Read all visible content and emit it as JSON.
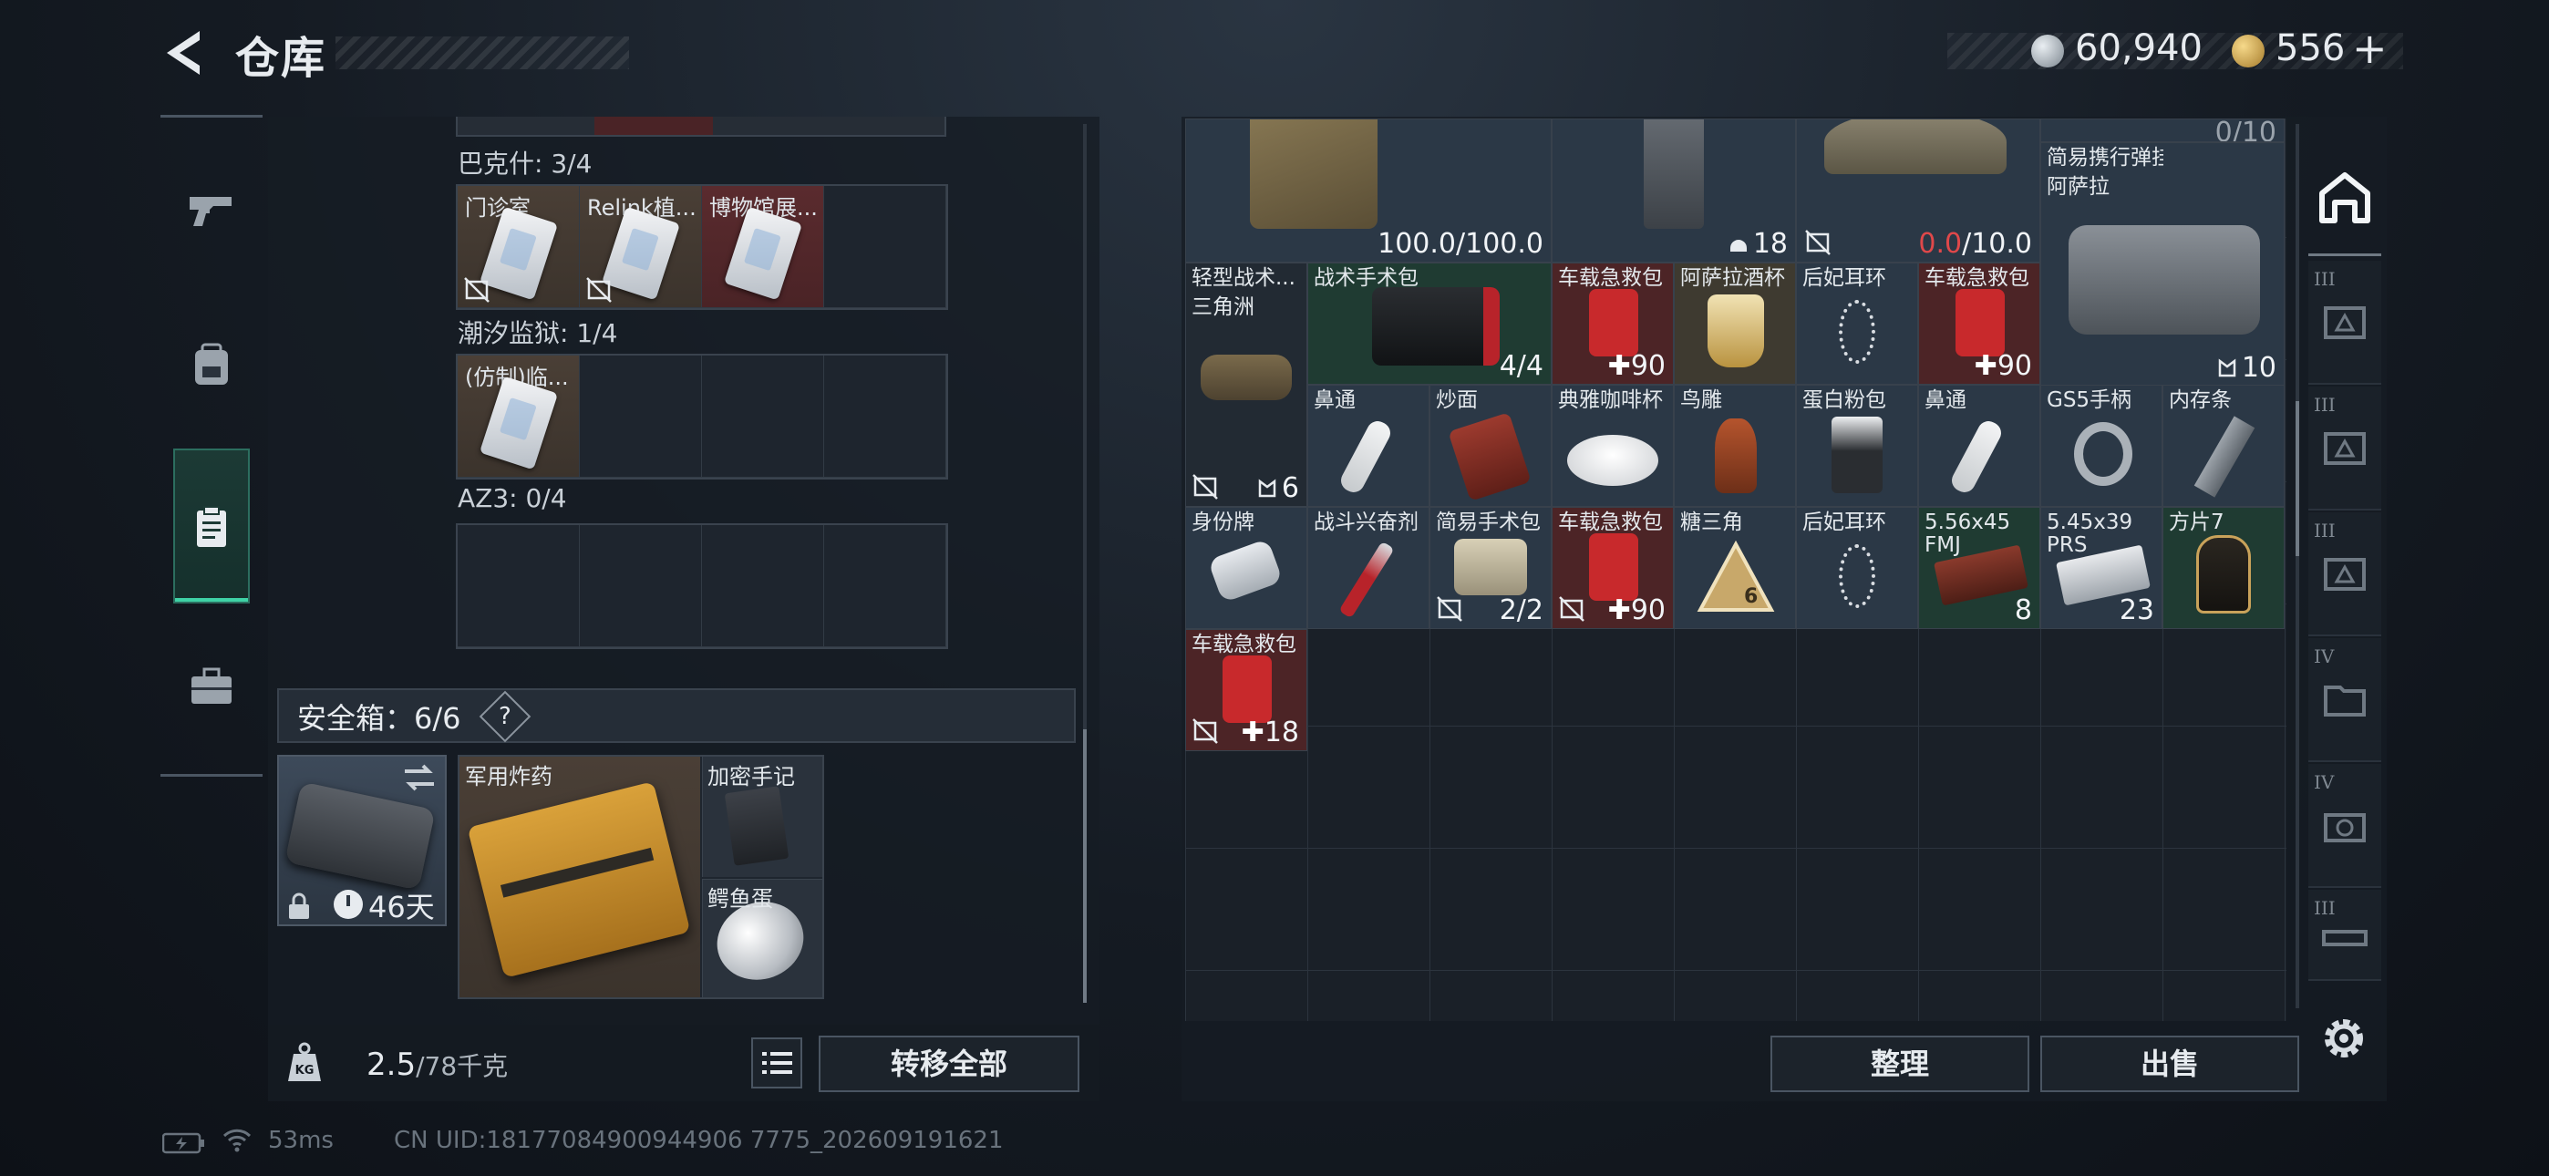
{
  "header": {
    "title": "仓库",
    "currency_silver": "60,940",
    "currency_gold": "556",
    "currency_plus": "+"
  },
  "left_rail": {
    "items": [
      {
        "icon": "pistol-icon"
      },
      {
        "icon": "backpack-icon"
      },
      {
        "icon": "clipboard-icon",
        "active": true
      },
      {
        "icon": "toolbox-icon"
      }
    ]
  },
  "collections": [
    {
      "label": "巴克什: 3/4",
      "cells": [
        "门诊室",
        "Relink植...",
        "博物馆展...",
        ""
      ]
    },
    {
      "label": "潮汐监狱: 1/4",
      "cells": [
        "(仿制)临...",
        "",
        "",
        ""
      ]
    },
    {
      "label": "AZ3: 0/4",
      "cells": [
        "",
        "",
        "",
        ""
      ]
    }
  ],
  "safe": {
    "header": "安全箱：6/6",
    "help": "?",
    "days": "46天",
    "items": {
      "explosive": "军用炸药",
      "notebook": "加密手记",
      "egg": "鳄鱼蛋"
    }
  },
  "footer_left": {
    "weight_current": "2.5",
    "weight_max": "/78千克",
    "transfer_label": "转移全部"
  },
  "inventory": {
    "top_counts": {
      "vest": "100.0/100.0",
      "pants": "18",
      "hat_current": "0.0",
      "hat_max": "/10.0",
      "partial": "0/10"
    },
    "bag": {
      "name": "简易携行弹挂",
      "sub": "阿萨拉",
      "count": "10"
    },
    "duffel": {
      "name": "轻型战术...",
      "sub": "三角洲",
      "count": "6"
    },
    "cells": {
      "surgical_kit": {
        "name": "战术手术包",
        "count": "4/4"
      },
      "firstaid_1": {
        "name": "车载急救包",
        "count": "90"
      },
      "cup": {
        "name": "阿萨拉酒杯"
      },
      "earring_1": {
        "name": "后妃耳环"
      },
      "firstaid_2": {
        "name": "车载急救包",
        "count": "90"
      },
      "inhaler_1": {
        "name": "鼻通"
      },
      "noodles": {
        "name": "炒面"
      },
      "coffee_cup": {
        "name": "典雅咖啡杯"
      },
      "bird": {
        "name": "鸟雕"
      },
      "protein": {
        "name": "蛋白粉包"
      },
      "inhaler_2": {
        "name": "鼻通"
      },
      "gs5": {
        "name": "GS5手柄"
      },
      "ram": {
        "name": "内存条"
      },
      "dogtag": {
        "name": "身份牌"
      },
      "stim": {
        "name": "战斗兴奋剂"
      },
      "simple_kit": {
        "name": "简易手术包",
        "count": "2/2"
      },
      "firstaid_3": {
        "name": "车载急救包",
        "count": "90"
      },
      "triangle": {
        "name": "糖三角"
      },
      "earring_2": {
        "name": "后妃耳环"
      },
      "ammo_556": {
        "name": "5.56x45",
        "sub": "FMJ",
        "count": "8"
      },
      "ammo_545": {
        "name": "5.45x39",
        "sub": "PRS",
        "count": "23"
      },
      "chip": {
        "name": "方片7"
      },
      "firstaid_4": {
        "name": "车载急救包",
        "count": "18"
      }
    },
    "sort_label": "整理",
    "sell_label": "出售"
  },
  "right_rail": {
    "tiers": [
      "III",
      "III",
      "III",
      "IV",
      "IV",
      "III"
    ]
  },
  "status": {
    "ping": "53ms",
    "uid": "CN UID:18177084900944906 7775_202609191621"
  },
  "colors": {
    "accent": "#3fd2a6",
    "alert": "#e0484a"
  }
}
